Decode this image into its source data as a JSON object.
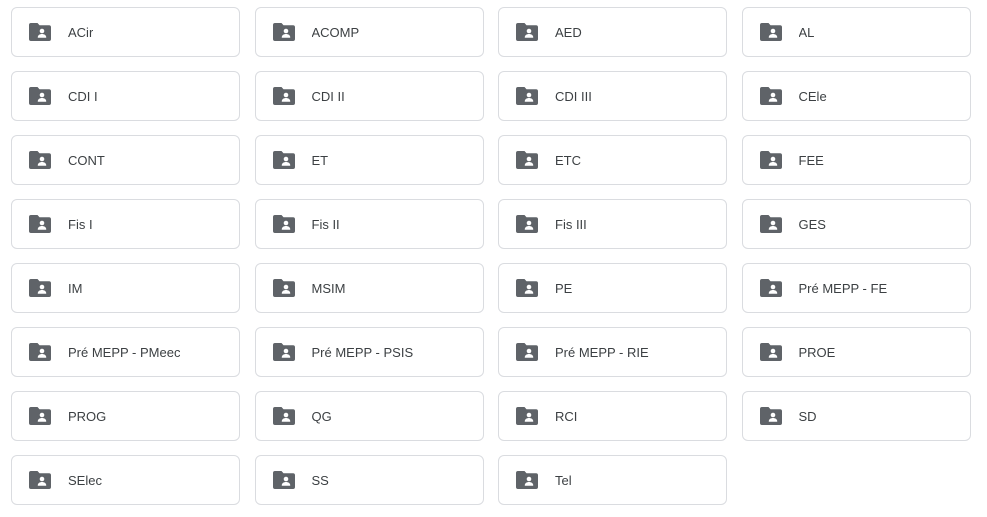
{
  "folder_icon": "shared-folder-icon",
  "colors": {
    "icon": "#5f6368",
    "border": "#dadce0",
    "text": "#3c4043"
  },
  "folders": [
    "ACir",
    "ACOMP",
    "AED",
    "AL",
    "CDI I",
    "CDI II",
    "CDI III",
    "CEle",
    "CONT",
    "ET",
    "ETC",
    "FEE",
    "Fis I",
    "Fis II",
    "Fis III",
    "GES",
    "IM",
    "MSIM",
    "PE",
    "Pré MEPP - FE",
    "Pré MEPP - PMeec",
    "Pré MEPP - PSIS",
    "Pré MEPP - RIE",
    "PROE",
    "PROG",
    "QG",
    "RCI",
    "SD",
    "SElec",
    "SS",
    "Tel"
  ]
}
